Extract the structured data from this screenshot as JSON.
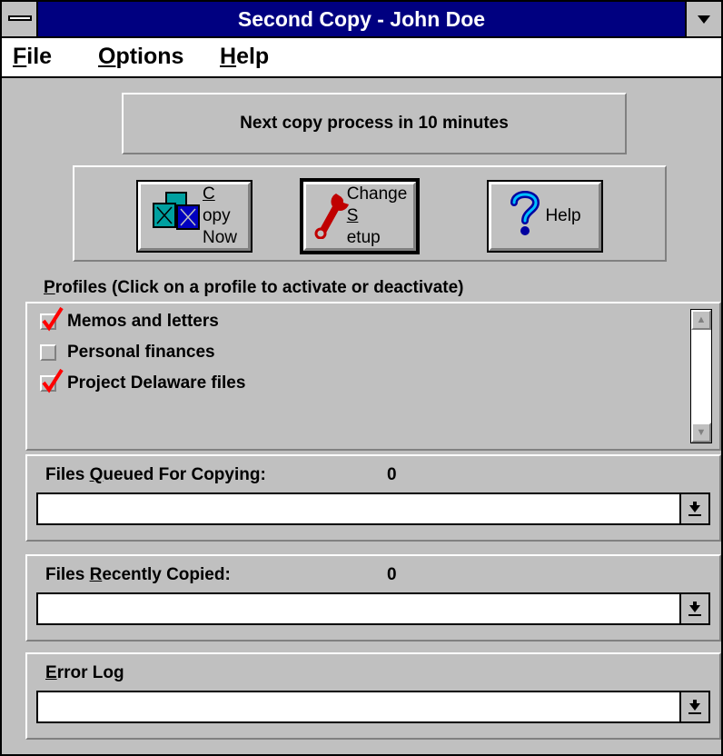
{
  "window": {
    "title": "Second Copy - John Doe"
  },
  "menu": {
    "file_mn": "F",
    "file_rest": "ile",
    "options_mn": "O",
    "options_rest": "ptions",
    "help_mn": "H",
    "help_rest": "elp"
  },
  "status": {
    "text": "Next copy process in  10 minutes"
  },
  "toolbar": {
    "copy_line1_mn": "C",
    "copy_line1_rest": "opy",
    "copy_line2": "Now",
    "change_line1": "Change",
    "change_line2_mn": "S",
    "change_line2_rest": "etup",
    "help_label": "Help"
  },
  "profiles": {
    "label_mn": "P",
    "label_rest": "rofiles (Click on a profile to activate or deactivate)",
    "items": [
      {
        "name": "Memos and letters",
        "checked": true
      },
      {
        "name": "Personal finances",
        "checked": false
      },
      {
        "name": "Project Delaware files",
        "checked": true
      }
    ]
  },
  "queued": {
    "label_pre": "Files ",
    "label_mn": "Q",
    "label_rest": "ueued For Copying:",
    "count": "0"
  },
  "recent": {
    "label_pre": "Files ",
    "label_mn": "R",
    "label_rest": "ecently Copied:",
    "count": "0"
  },
  "errorlog": {
    "label_mn": "E",
    "label_rest": "rror Log"
  },
  "colors": {
    "titlebar": "#000080",
    "face": "#c0c0c0",
    "checkmark": "#ff0000"
  }
}
